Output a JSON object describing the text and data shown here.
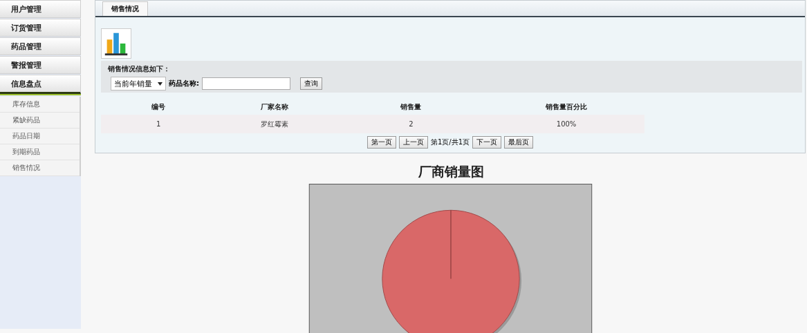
{
  "sidebar": {
    "menus": [
      {
        "label": "用户管理",
        "expanded": false
      },
      {
        "label": "订货管理",
        "expanded": false
      },
      {
        "label": "药品管理",
        "expanded": false
      },
      {
        "label": "警报管理",
        "expanded": false
      },
      {
        "label": "信息盘点",
        "expanded": true,
        "children": [
          {
            "label": "库存信息"
          },
          {
            "label": "紧缺药品"
          },
          {
            "label": "药品日期"
          },
          {
            "label": "到期药品"
          },
          {
            "label": "销售情况"
          }
        ]
      }
    ]
  },
  "tabs": [
    {
      "label": "销售情况",
      "selected": true
    }
  ],
  "filter": {
    "caption": "销售情况信息如下：",
    "period": "当前年销量",
    "name_label": "药品名称:",
    "search_button": "查询"
  },
  "table": {
    "columns": [
      "编号",
      "厂家名称",
      "销售量",
      "销售量百分比"
    ],
    "rows": [
      [
        "1",
        "罗红霉素",
        "2",
        "100%"
      ]
    ]
  },
  "pager": {
    "first": "第一页",
    "prev": "上一页",
    "info": "第1页/共1页",
    "next": "下一页",
    "last": "最后页"
  },
  "chart": {
    "title": "厂商销量图",
    "kind": "picture"
  }
}
